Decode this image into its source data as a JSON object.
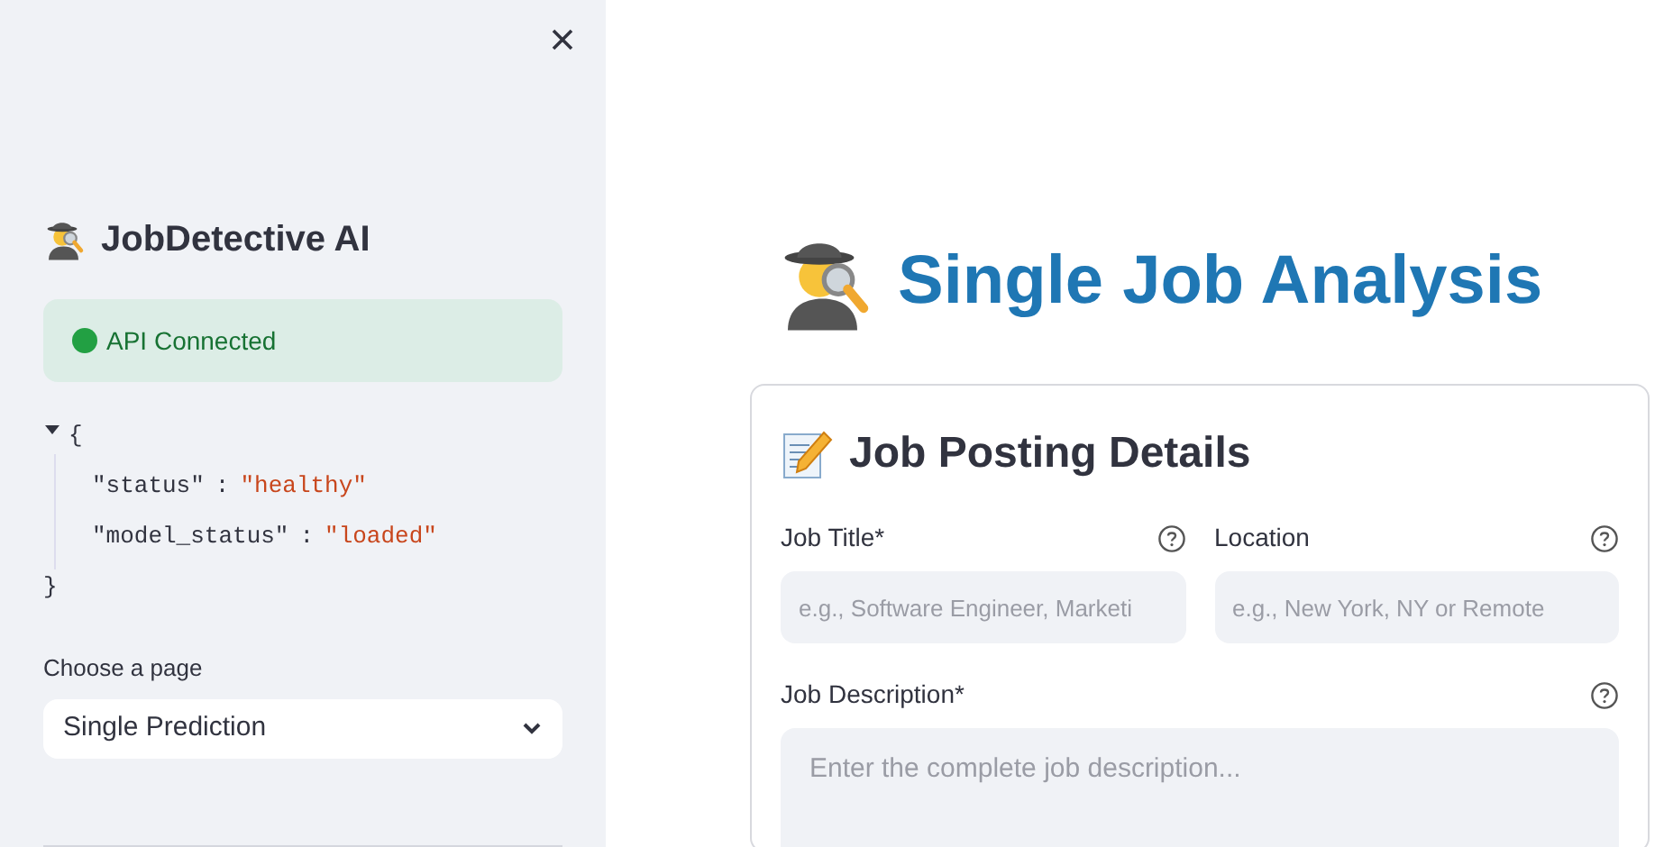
{
  "sidebar": {
    "title": "JobDetective AI",
    "status_alert": {
      "text": "API Connected",
      "color": "#22a043"
    },
    "json_view": {
      "expanded": true,
      "open": "{",
      "close": "}",
      "separator": ":",
      "entries": [
        {
          "key": "\"status\"",
          "value": "\"healthy\""
        },
        {
          "key": "\"model_status\"",
          "value": "\"loaded\""
        }
      ]
    },
    "page_select": {
      "label": "Choose a page",
      "value": "Single Prediction"
    }
  },
  "main": {
    "title": "Single Job Analysis",
    "card": {
      "title": "Job Posting Details",
      "fields": [
        {
          "label": "Job Title*",
          "placeholder": "e.g., Software Engineer, Marketi",
          "kind": "input"
        },
        {
          "label": "Location",
          "placeholder": "e.g., New York, NY or Remote",
          "kind": "input"
        },
        {
          "label": "Job Description*",
          "placeholder": "Enter the complete job description...",
          "kind": "textarea"
        }
      ]
    }
  }
}
